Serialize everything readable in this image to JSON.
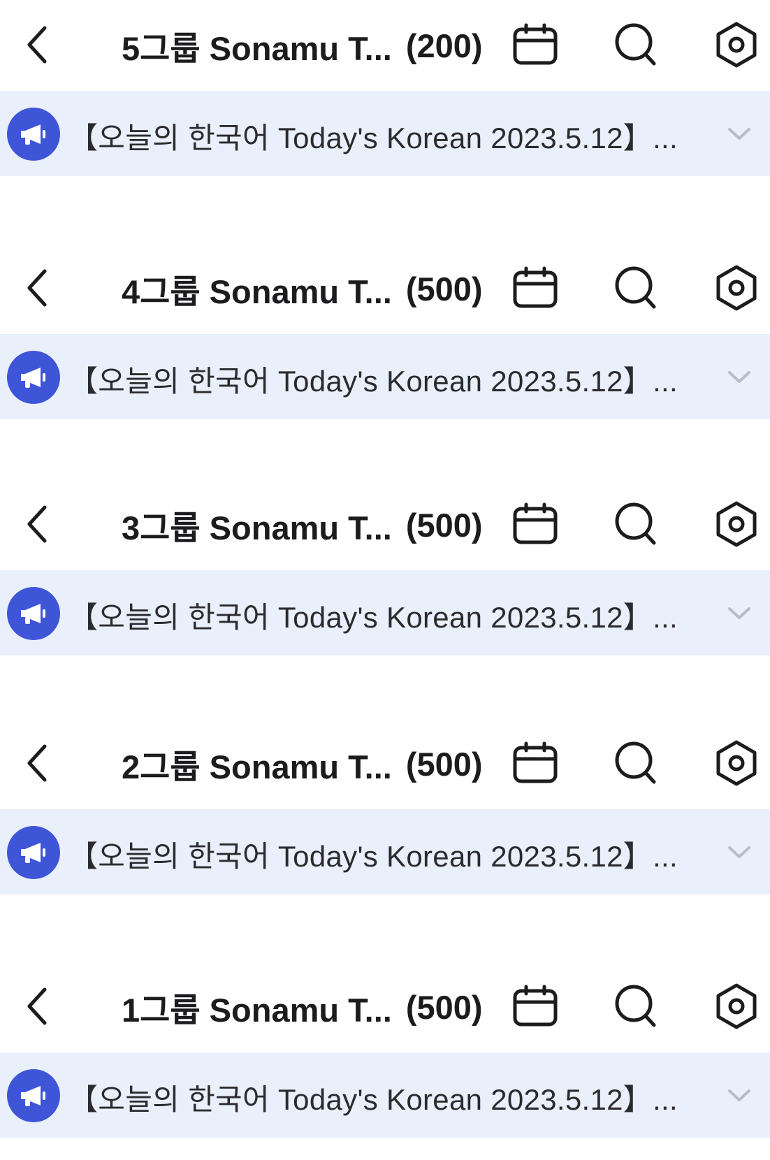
{
  "colors": {
    "accent": "#3f55d8",
    "notice_bg": "#eaf0fb",
    "text": "#1c1c1e",
    "chevron": "#b8bcc6"
  },
  "icons": {
    "back": "chevron-left-icon",
    "calendar": "calendar-icon",
    "search": "search-icon",
    "settings": "settings-hexagon-icon",
    "notice": "megaphone-icon",
    "expand": "chevron-down-icon"
  },
  "screens": [
    {
      "title": "5그룹 Sonamu T...",
      "count": "(200)",
      "notice": "【오늘의 한국어 Today's Korean 2023.5.12】..."
    },
    {
      "title": "4그룹 Sonamu T...",
      "count": "(500)",
      "notice": "【오늘의 한국어 Today's Korean 2023.5.12】..."
    },
    {
      "title": "3그룹 Sonamu T...",
      "count": "(500)",
      "notice": "【오늘의 한국어 Today's Korean 2023.5.12】..."
    },
    {
      "title": "2그룹 Sonamu T...",
      "count": "(500)",
      "notice": "【오늘의 한국어 Today's Korean 2023.5.12】..."
    },
    {
      "title": "1그룹 Sonamu T...",
      "count": "(500)",
      "notice": "【오늘의 한국어 Today's Korean 2023.5.12】..."
    }
  ]
}
